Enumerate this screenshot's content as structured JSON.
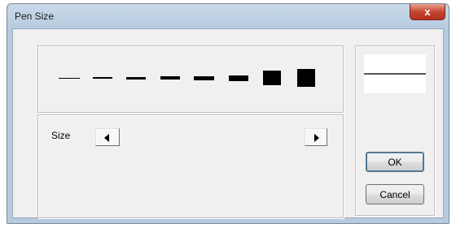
{
  "window": {
    "title": "Pen Size",
    "close_label": "x"
  },
  "pens": [
    {
      "name": "pen-size-1",
      "thickness": 1
    },
    {
      "name": "pen-size-2",
      "thickness": 2
    },
    {
      "name": "pen-size-3",
      "thickness": 3
    },
    {
      "name": "pen-size-4",
      "thickness": 4
    },
    {
      "name": "pen-size-5",
      "thickness": 5
    },
    {
      "name": "pen-size-6",
      "thickness": 7
    },
    {
      "name": "pen-size-7",
      "thickness": 18
    },
    {
      "name": "pen-size-8",
      "thickness": 22
    }
  ],
  "size": {
    "label": "Size",
    "left_icon": "arrow-left-icon",
    "right_icon": "arrow-right-icon"
  },
  "buttons": {
    "ok": "OK",
    "cancel": "Cancel"
  },
  "colors": {
    "pen": "#000000",
    "preview_line": "#555555"
  }
}
